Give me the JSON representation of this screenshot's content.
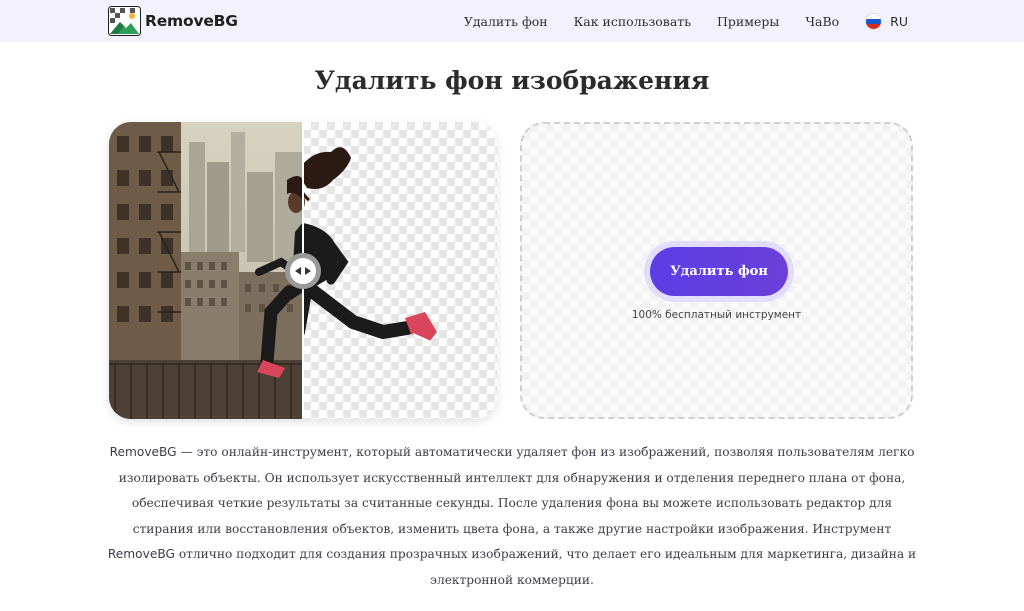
{
  "header": {
    "logo_text": "RemoveBG",
    "nav": [
      {
        "label": "Удалить фон"
      },
      {
        "label": "Как использовать"
      },
      {
        "label": "Примеры"
      },
      {
        "label": "ЧаВо"
      }
    ],
    "language": {
      "label": "RU",
      "flag_colors": [
        "#ffffff",
        "#1c57c9",
        "#d52b1e"
      ]
    }
  },
  "main": {
    "title": "Удалить фон изображения",
    "upload": {
      "button_label": "Удалить фон",
      "free_label": "100% бесплатный инструмент"
    },
    "description": {
      "brand_1": "RemoveBG",
      "part_1": " — это онлайн-инструмент, который автоматически удаляет фон из изображений, позволяя пользователям легко изолировать объекты. Он использует искусственный интеллект для обнаружения и отделения переднего плана от фона, обеспечивая четкие результаты за считанные секунды. После удаления фона вы можете использовать редактор для стирания или восстановления объектов, изменить цвета фона, а также другие настройки изображения. Инструмент ",
      "brand_2": "RemoveBG",
      "part_2": " отлично подходит для создания прозрачных изображений, что делает его идеальным для маркетинга, дизайна и электронной коммерции."
    }
  },
  "colors": {
    "header_bg": "#f3f2fc",
    "accent": "#5a3fe5",
    "button_ring": "#e1ddfb"
  }
}
